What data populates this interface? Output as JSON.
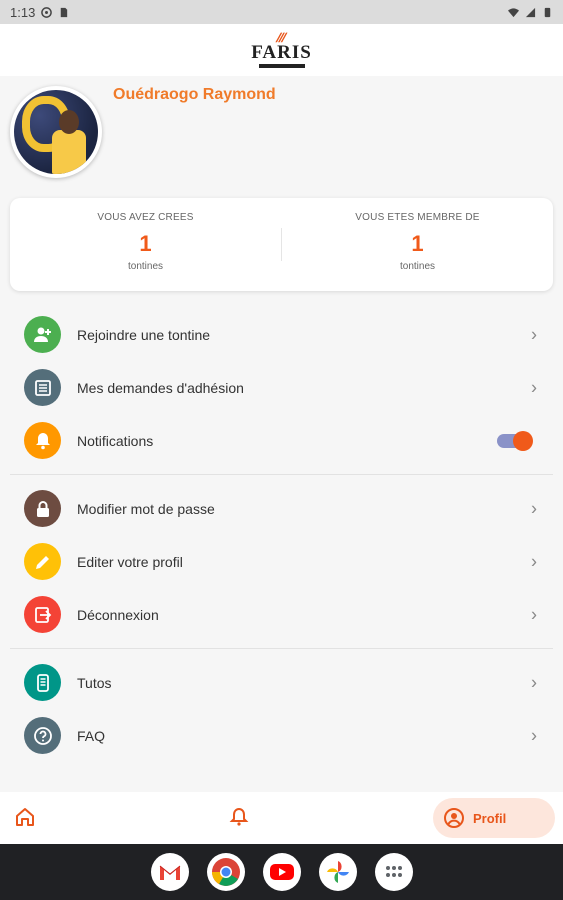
{
  "status_bar": {
    "time": "1:13"
  },
  "header": {
    "logo_text": "FARIS"
  },
  "profile": {
    "name": "Ouédraogo Raymond"
  },
  "stats": [
    {
      "label": "VOUS AVEZ CREES",
      "value": "1",
      "unit": "tontines"
    },
    {
      "label": "VOUS ETES MEMBRE DE",
      "value": "1",
      "unit": "tontines"
    }
  ],
  "menu": {
    "group1": [
      {
        "label": "Rejoindre une tontine",
        "icon": "person-add-icon",
        "color": "#4caf50"
      },
      {
        "label": "Mes demandes d'adhésion",
        "icon": "list-icon",
        "color": "#546e7a"
      },
      {
        "label": "Notifications",
        "icon": "bell-icon",
        "color": "#ff9800",
        "toggle_on": true
      }
    ],
    "group2": [
      {
        "label": "Modifier mot de passe",
        "icon": "lock-icon",
        "color": "#6d4c41"
      },
      {
        "label": "Editer votre profil",
        "icon": "pencil-icon",
        "color": "#ffc107"
      },
      {
        "label": "Déconnexion",
        "icon": "logout-icon",
        "color": "#f44336"
      }
    ],
    "group3": [
      {
        "label": "Tutos",
        "icon": "phone-icon",
        "color": "#009688"
      },
      {
        "label": "FAQ",
        "icon": "help-icon",
        "color": "#546e7a"
      }
    ]
  },
  "bottom_nav": {
    "home_icon": "home-icon",
    "notifications_icon": "bell-icon",
    "profile_label": "Profil",
    "accent": "#e8561b"
  },
  "dock": [
    "gmail-icon",
    "chrome-icon",
    "youtube-icon",
    "photos-icon",
    "apps-icon"
  ]
}
